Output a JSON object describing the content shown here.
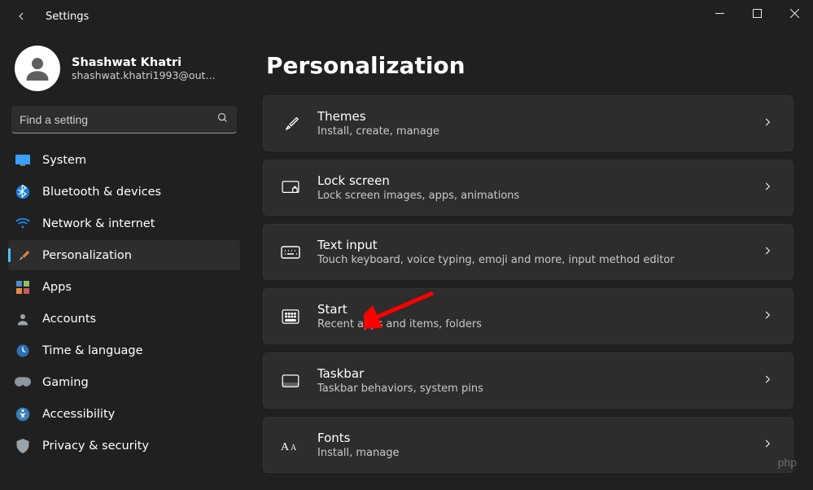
{
  "window": {
    "title": "Settings"
  },
  "user": {
    "name": "Shashwat Khatri",
    "email": "shashwat.khatri1993@out…"
  },
  "search": {
    "placeholder": "Find a setting"
  },
  "page": {
    "title": "Personalization"
  },
  "nav": [
    {
      "label": "System",
      "icon": "display-icon",
      "active": false
    },
    {
      "label": "Bluetooth & devices",
      "icon": "bluetooth-icon",
      "active": false
    },
    {
      "label": "Network & internet",
      "icon": "wifi-icon",
      "active": false
    },
    {
      "label": "Personalization",
      "icon": "brush-icon",
      "active": true
    },
    {
      "label": "Apps",
      "icon": "apps-icon",
      "active": false
    },
    {
      "label": "Accounts",
      "icon": "person-icon",
      "active": false
    },
    {
      "label": "Time & language",
      "icon": "clock-icon",
      "active": false
    },
    {
      "label": "Gaming",
      "icon": "gamepad-icon",
      "active": false
    },
    {
      "label": "Accessibility",
      "icon": "accessibility-icon",
      "active": false
    },
    {
      "label": "Privacy & security",
      "icon": "shield-icon",
      "active": false
    }
  ],
  "cards": [
    {
      "title": "Themes",
      "desc": "Install, create, manage",
      "icon": "themes-icon"
    },
    {
      "title": "Lock screen",
      "desc": "Lock screen images, apps, animations",
      "icon": "lockscreen-icon"
    },
    {
      "title": "Text input",
      "desc": "Touch keyboard, voice typing, emoji and more, input method editor",
      "icon": "keyboard-icon"
    },
    {
      "title": "Start",
      "desc": "Recent apps and items, folders",
      "icon": "start-icon"
    },
    {
      "title": "Taskbar",
      "desc": "Taskbar behaviors, system pins",
      "icon": "taskbar-icon"
    },
    {
      "title": "Fonts",
      "desc": "Install, manage",
      "icon": "fonts-icon"
    }
  ],
  "watermark": "php"
}
